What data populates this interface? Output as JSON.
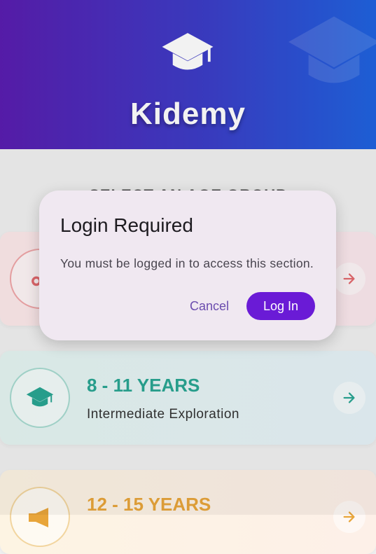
{
  "app": {
    "brand": "Kidemy"
  },
  "section": {
    "title": "SELECT AN AGE GROUP"
  },
  "cards": [
    {
      "title": "",
      "subtitle": ""
    },
    {
      "title": "8 - 11 YEARS",
      "subtitle": "Intermediate Exploration"
    },
    {
      "title": "12 - 15 YEARS",
      "subtitle": ""
    }
  ],
  "dialog": {
    "title": "Login Required",
    "message": "You must be logged in to access this section.",
    "cancel_label": "Cancel",
    "login_label": "Log In"
  },
  "colors": {
    "header_start": "#5a1db0",
    "header_end": "#1f63e0",
    "card1_accent": "#e46a6e",
    "card2_accent": "#2aa693",
    "card3_accent": "#e8a53a",
    "primary_button": "#6a1bd6"
  },
  "icons": {
    "header": "graduation-cap-icon",
    "card1": "rocking-horse-icon",
    "card2": "graduation-cap-icon",
    "card3": "megaphone-icon",
    "card_arrow": "arrow-right-icon"
  }
}
